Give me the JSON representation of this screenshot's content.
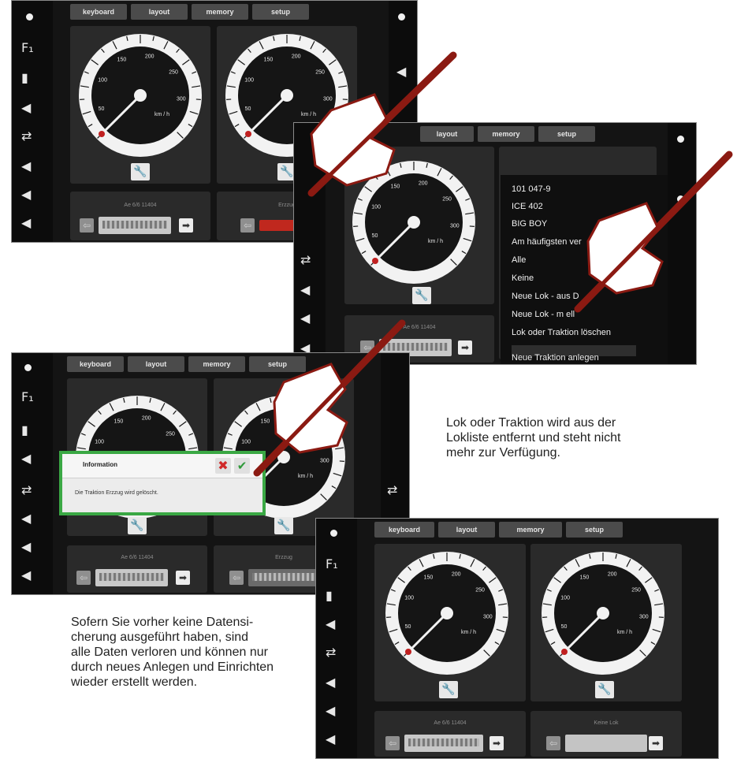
{
  "tabs": {
    "keyboard": "keyboard",
    "layout": "layout",
    "memory": "memory",
    "setup": "setup"
  },
  "sidebar_icons": [
    "light-icon",
    "f1-icon",
    "function-icon",
    "horn-icon",
    "shunting-icon",
    "sound-icon",
    "sound-icon",
    "sound-icon"
  ],
  "gauge": {
    "unit": "km / h",
    "ticks": [
      "50",
      "100",
      "150",
      "200",
      "250",
      "300"
    ]
  },
  "screen1": {
    "loco_left": "Ae 6/6 11404",
    "loco_right": "Erzzug"
  },
  "screen2": {
    "loco_left": "Ae 6/6 11404",
    "menu": [
      "101 047-9",
      "ICE 402",
      "BIG BOY",
      "Am häufigsten verwendet",
      "Alle",
      "Keine",
      "Neue Lok - aus Datenbank",
      "Neue Lok - manuell",
      "Lok oder Traktion löschen",
      "",
      "Neue Traktion anlegen"
    ],
    "menu_shown": [
      "101 047-9",
      "ICE 402",
      "BIG BOY",
      "Am häufigsten ver",
      "Alle",
      "Keine",
      "Neue Lok - aus D",
      "Neue Lok - m      ell",
      "Lok oder Traktion löschen",
      "",
      "Neue Traktion anlegen"
    ]
  },
  "screen3": {
    "dialog_title": "Information",
    "dialog_message": "Die Traktion Erzzug wird gelöscht.",
    "loco_left": "Ae 6/6 11404",
    "loco_right": "Erzzug"
  },
  "screen4": {
    "loco_left": "Ae 6/6 11404",
    "loco_right": "Keine Lok"
  },
  "caption_right": [
    "Lok oder Traktion wird aus der",
    "Lokliste entfernt und steht nicht",
    "mehr zur Verfügung."
  ],
  "caption_left": [
    "Sofern Sie vorher keine Datensi-",
    "cherung ausgeführt haben, sind",
    "alle Daten verloren und können nur",
    "durch neues Anlegen und Einrichten",
    "wieder erstellt werden."
  ],
  "colors": {
    "screen_bg": "#141414",
    "panel": "#2a2a2a",
    "accent_red": "#b02020",
    "dialog_border": "#3aa844",
    "pen": "#8b1a12"
  }
}
